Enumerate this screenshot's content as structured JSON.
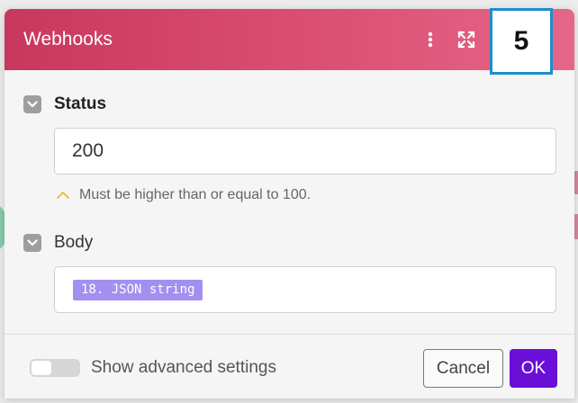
{
  "dialog": {
    "title": "Webhooks",
    "badge": "5",
    "accent_color": "#d94a70",
    "icons": [
      "more-vertical-icon",
      "expand-icon"
    ]
  },
  "fields": {
    "status": {
      "label": "Status",
      "value": "200",
      "hint": "Must be higher than or equal to 100."
    },
    "body": {
      "label": "Body",
      "token": "18. JSON string",
      "token_color": "#a38ff0"
    }
  },
  "footer": {
    "advanced_label": "Show advanced settings",
    "advanced_enabled": false,
    "cancel_label": "Cancel",
    "ok_label": "OK",
    "ok_color": "#6a0fd8"
  }
}
